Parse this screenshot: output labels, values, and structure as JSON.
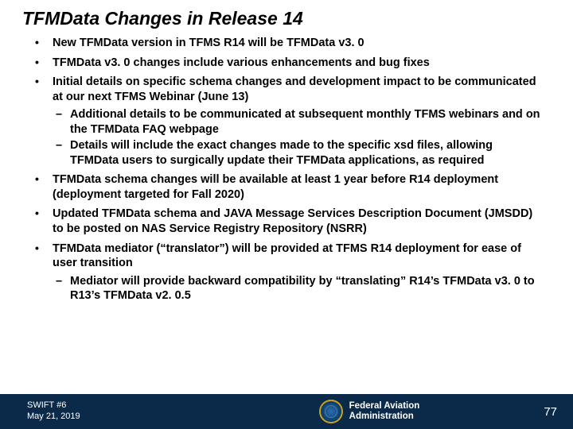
{
  "title": "TFMData Changes in Release 14",
  "bullets": [
    {
      "text": "New TFMData version in TFMS R14 will be TFMData v3. 0",
      "sub": []
    },
    {
      "text": "TFMData v3. 0 changes include various enhancements and bug fixes",
      "sub": []
    },
    {
      "text": "Initial details on specific schema changes and development impact to be communicated at our next TFMS Webinar (June 13)",
      "sub": [
        "Additional details to be communicated at subsequent monthly TFMS webinars and on the TFMData FAQ webpage",
        "Details will include the exact changes made to the specific xsd files, allowing TFMData users to surgically update their TFMData applications, as required"
      ]
    },
    {
      "text": "TFMData schema changes will be available at least 1 year before R14 deployment (deployment targeted for Fall 2020)",
      "sub": []
    },
    {
      "text": "Updated TFMData schema and JAVA Message Services Description Document (JMSDD) to be posted on NAS Service Registry Repository (NSRR)",
      "sub": []
    },
    {
      "text": "TFMData mediator (“translator”) will be provided at TFMS R14 deployment for ease of user transition",
      "sub": [
        "Mediator will provide backward compatibility by “translating” R14’s TFMData v3. 0 to R13’s TFMData v2. 0.5"
      ]
    }
  ],
  "footer": {
    "left_line1": "SWIFT #6",
    "left_line2": "May 21, 2019",
    "agency_line1": "Federal Aviation",
    "agency_line2": "Administration",
    "page": "77"
  }
}
